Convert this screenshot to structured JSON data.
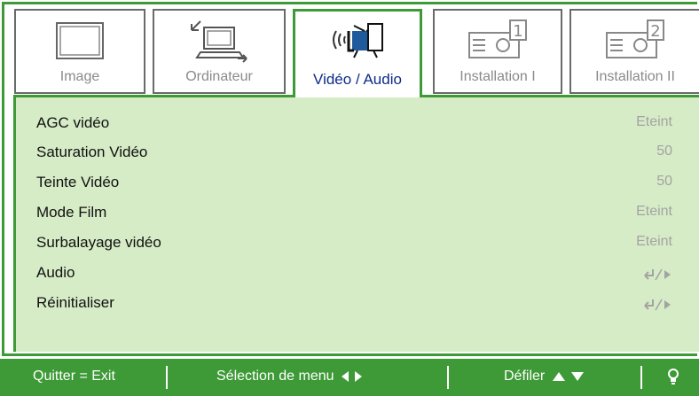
{
  "tabs": [
    {
      "label": "Image",
      "icon": "monitor-icon",
      "active": false
    },
    {
      "label": "Ordinateur",
      "icon": "computer-input-icon",
      "active": false
    },
    {
      "label": "Vidéo / Audio",
      "icon": "video-audio-icon",
      "active": true
    },
    {
      "label": "Installation I",
      "icon": "projector-1-icon",
      "active": false
    },
    {
      "label": "Installation II",
      "icon": "projector-2-icon",
      "active": false
    }
  ],
  "menu": [
    {
      "label": "AGC vidéo",
      "value": "Eteint"
    },
    {
      "label": "Saturation Vidéo",
      "value": "50"
    },
    {
      "label": "Teinte Vidéo",
      "value": "50"
    },
    {
      "label": "Mode Film",
      "value": "Eteint"
    },
    {
      "label": "Surbalayage vidéo",
      "value": "Eteint"
    },
    {
      "label": "Audio",
      "value_icon": "enter-submenu-icon"
    },
    {
      "label": "Réinitialiser",
      "value_icon": "enter-submenu-icon"
    }
  ],
  "footer": {
    "exit": "Quitter = Exit",
    "select": "Sélection de menu",
    "scroll": "Défiler",
    "help_icon": "lightbulb-icon"
  },
  "colors": {
    "accent": "#3d9a36",
    "panel": "#d6ecc6",
    "active_label": "#0e2a8a"
  }
}
